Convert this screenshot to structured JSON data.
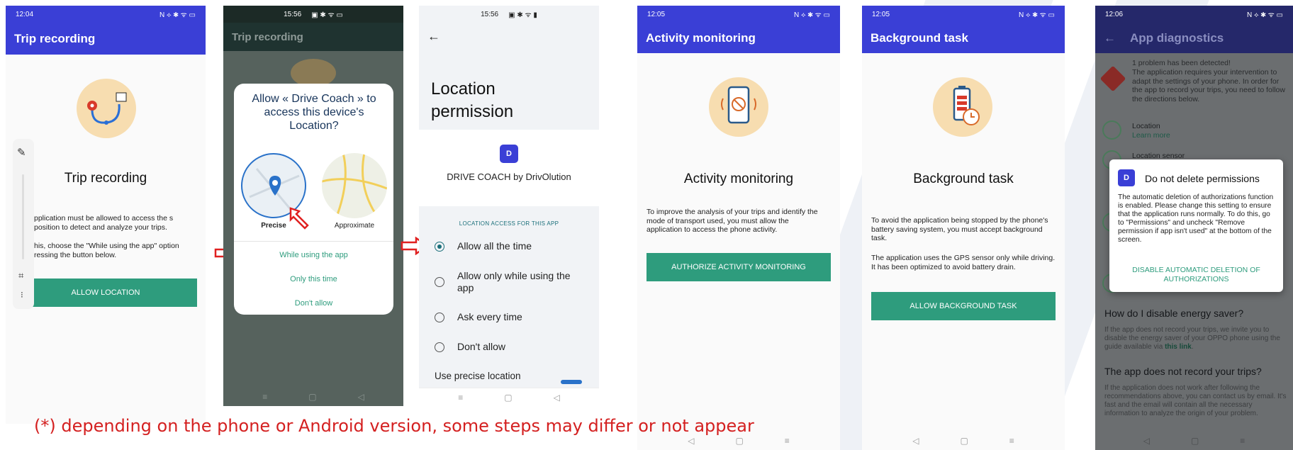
{
  "colors": {
    "primary": "#3a3fd6",
    "accent": "#2e9c7d",
    "footnote": "#d42020",
    "arrow": "#e02020"
  },
  "screen1": {
    "status_time": "12:04",
    "status_icons_right": "N ⟡ ✱ ᯤ ▭",
    "appbar_title": "Trip recording",
    "title": "Trip recording",
    "text1": "pplication must be allowed to access the s position to detect and analyze your trips.",
    "text2": "his, choose the \"While using the app\" option ressing the button below.",
    "button": "ALLOW LOCATION"
  },
  "screen2": {
    "status_time": "15:56",
    "appbar_title": "Trip recording",
    "dialog_title": "Allow « Drive Coach » to access this device's Location?",
    "precise_label": "Precise",
    "approximate_label": "Approximate",
    "option1": "While using the app",
    "option2": "Only this time",
    "option3": "Don't allow"
  },
  "screen3": {
    "status_time": "15:56",
    "title": "Location permission",
    "app_name": "DRIVE COACH by DrivOlution",
    "section_label": "LOCATION  ACCESS FOR THIS APP",
    "options": [
      "Allow all the time",
      "Allow only while using the app",
      "Ask every time",
      "Don't allow"
    ],
    "selected_option": "Allow all the time",
    "precise": "Use precise location"
  },
  "screen4": {
    "status_time": "12:05",
    "appbar_title": "Activity monitoring",
    "title": "Activity monitoring",
    "text": "To improve the analysis of your trips and identify the mode of transport used, you must allow the application to access the phone activity.",
    "button": "AUTHORIZE ACTIVITY MONITORING"
  },
  "screen5": {
    "status_time": "12:05",
    "appbar_title": "Background task",
    "title": "Background task",
    "text1": "To avoid the application being stopped by the phone's battery saving system, you must accept background task.",
    "text2": "The application uses the GPS sensor only while driving. It has been optimized to avoid battery drain.",
    "button": "ALLOW BACKGROUND TASK"
  },
  "screen6": {
    "status_time": "12:06",
    "appbar_title": "App diagnostics",
    "problem_title": "1 problem has been detected!",
    "problem_text": "The application requires your intervention to adapt the settings of your phone. In order for the app to record your trips, you need to follow the directions below.",
    "item1_title": "Location",
    "item1_link": "Learn more",
    "item2_title": "Location sensor",
    "dialog_title": "Do not delete permissions",
    "dialog_text": "The automatic deletion of authorizations function is enabled. Please change this setting to ensure that the application runs normally. To do this, go to \"Permissions\" and uncheck \"Remove permission if app isn't used\" at the bottom of the screen.",
    "dialog_button": "DISABLE AUTOMATIC DELETION OF AUTHORIZATIONS",
    "faq1_title": "How do I disable energy saver?",
    "faq1_text": "If the app does not record your trips, we invite you to disable the energy saver of your OPPO phone using the guide available via",
    "faq1_link": "this link",
    "faq2_title": "The app does not record your trips?",
    "faq2_text": "If the application does not work after following the recommendations above, you can contact us by email. It's fast and the email will contain all the necessary information to analyze the origin of your problem."
  },
  "footnote": "(*) depending on the phone or Android version, some steps may differ or not appear"
}
